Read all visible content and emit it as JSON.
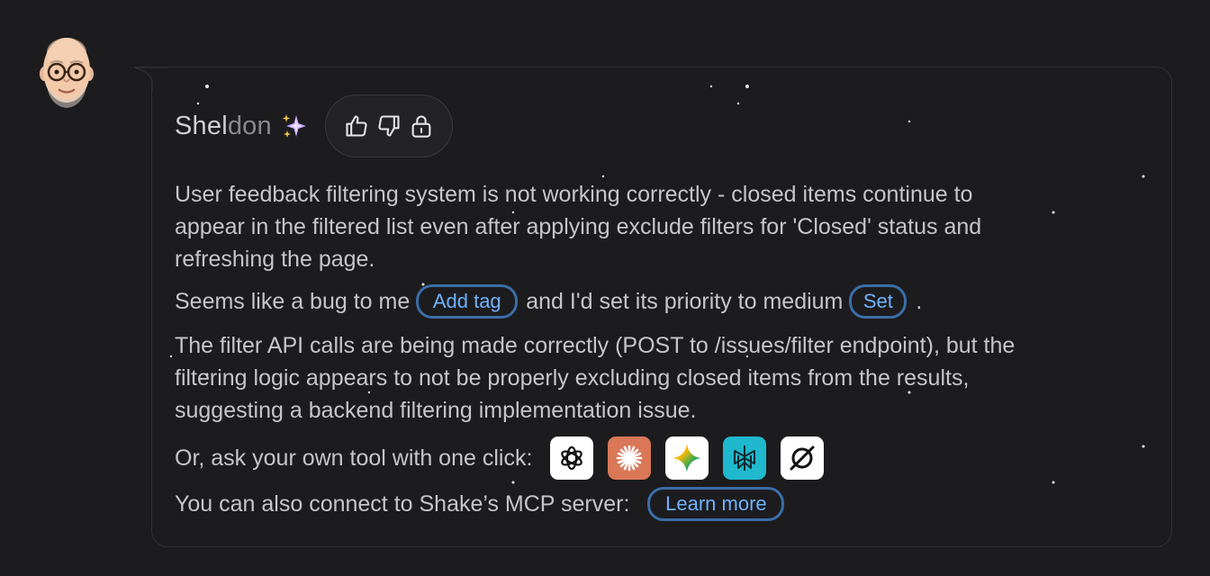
{
  "author": {
    "name_main": "Shel",
    "name_faded": "don",
    "sparkle_icon": "sparkles-icon"
  },
  "feedback": {
    "thumbs_up_icon": "thumbs-up-icon",
    "thumbs_down_icon": "thumbs-down-icon",
    "lock_icon": "lock-icon"
  },
  "message": {
    "summary_line1": "User feedback filtering system is not working correctly - closed items continue to",
    "summary_line2": "appear in the filtered list even after applying exclude filters for 'Closed' status and",
    "summary_line3": "refreshing the page.",
    "bug_prefix": "Seems like a bug to me",
    "add_tag_label": "Add tag",
    "priority_text": "and I'd set its priority to medium",
    "set_label": "Set",
    "priority_suffix": ".",
    "detail_line1": "The filter API calls are being made correctly (POST to /issues/filter endpoint), but the",
    "detail_line2": "filtering logic appears to not be properly excluding closed items from the results,",
    "detail_line3": "suggesting a backend filtering implementation issue.",
    "ask_text": "Or, ask your own tool with one click:",
    "mcp_text": "You can also connect to Shake’s MCP server:",
    "learn_more_label": "Learn more"
  },
  "tools": [
    {
      "icon": "chatgpt-icon",
      "bg": "#ffffff"
    },
    {
      "icon": "claude-icon",
      "bg": "#d97757"
    },
    {
      "icon": "gemini-icon",
      "bg": "#ffffff"
    },
    {
      "icon": "perplexity-icon",
      "bg": "#1fb8cd"
    },
    {
      "icon": "cursor-icon",
      "bg": "#ffffff"
    }
  ],
  "colors": {
    "background": "#1c1c1e",
    "accent": "#6fb2ff",
    "pill_border": "#3a6ea8",
    "text": "#c6c6c9"
  }
}
